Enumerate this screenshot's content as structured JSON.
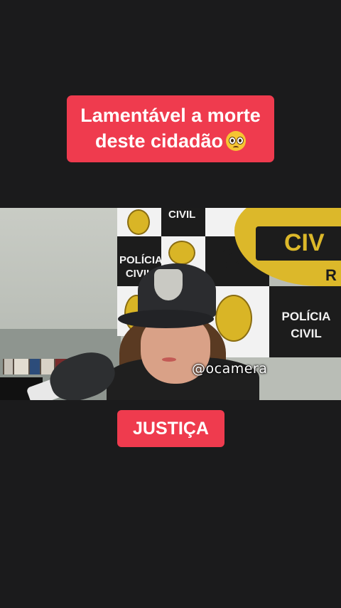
{
  "caption_top": {
    "line1": "Lamentável a morte",
    "line2": "deste cidadão",
    "emoji": "pleading-face-icon"
  },
  "video": {
    "background_text": {
      "civil_top": "CIVIL",
      "policia_civil_left": "POLÍCIA\nCIVIL",
      "policia_civil_mid": "POLÍCIA\nCIVIL",
      "policia_civil_right": "POLÍCIA\nCIVIL",
      "big_civ": "CIV",
      "big_r": "R"
    },
    "watermark": "@ocamera"
  },
  "caption_bottom": {
    "label": "JUSTIÇA"
  },
  "colors": {
    "caption_bg": "#ef3b4e",
    "page_bg": "#1b1b1c",
    "badge_gold": "#dcb82a"
  }
}
